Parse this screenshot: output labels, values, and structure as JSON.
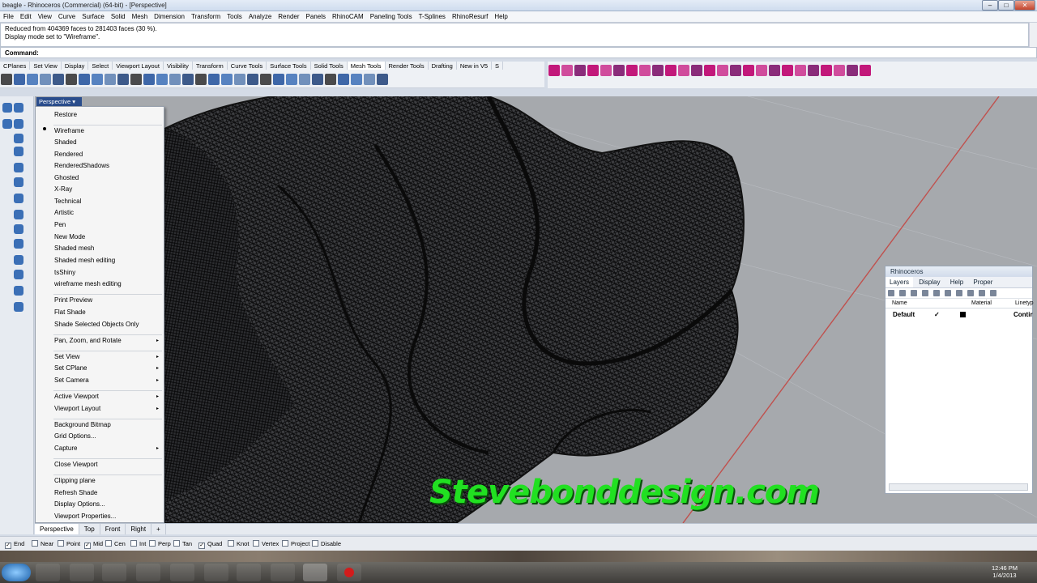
{
  "window": {
    "title": "beagle - Rhinoceros (Commercial) (64-bit) - [Perspective]"
  },
  "menu": [
    "File",
    "Edit",
    "View",
    "Curve",
    "Surface",
    "Solid",
    "Mesh",
    "Dimension",
    "Transform",
    "Tools",
    "Analyze",
    "Render",
    "Panels",
    "RhinoCAM",
    "Paneling Tools",
    "T-Splines",
    "RhinoResurf",
    "Help"
  ],
  "command_history": [
    "Reduced from 404369 faces to 281403 faces (30 %).",
    "Display mode set to \"Wireframe\"."
  ],
  "command": {
    "label": "Command:",
    "value": ""
  },
  "toolbar_tabs": [
    "CPlanes",
    "Set View",
    "Display",
    "Select",
    "Viewport Layout",
    "Visibility",
    "Transform",
    "Curve Tools",
    "Surface Tools",
    "Solid Tools",
    "Mesh Tools",
    "Render Tools",
    "Drafting",
    "New in V5",
    "S"
  ],
  "active_toolbar_tab": "Mesh Tools",
  "viewport": {
    "title": "Perspective"
  },
  "context_menu": {
    "items": [
      "Restore",
      "Wireframe",
      "Shaded",
      "Rendered",
      "RenderedShadows",
      "Ghosted",
      "X-Ray",
      "Technical",
      "Artistic",
      "Pen",
      "New Mode",
      "Shaded mesh",
      "Shaded mesh editing",
      "tsShiny",
      "wireframe mesh editing",
      "Print Preview",
      "Flat Shade",
      "Shade Selected Objects Only",
      "Pan, Zoom, and Rotate",
      "Set View",
      "Set CPlane",
      "Set Camera",
      "Active Viewport",
      "Viewport Layout",
      "Background Bitmap",
      "Grid Options...",
      "Capture",
      "Close Viewport",
      "Clipping plane",
      "Refresh Shade",
      "Display Options...",
      "Viewport Properties..."
    ],
    "checked": "Wireframe",
    "submenu_arrow": "▸"
  },
  "panel": {
    "title": "Rhinoceros",
    "tabs": [
      "Layers",
      "Display",
      "Help",
      "Proper"
    ],
    "columns": [
      "Name",
      "Material",
      "Linetyp"
    ],
    "rows": [
      {
        "name": "Default",
        "check": "✓",
        "linetype": "Contir"
      }
    ]
  },
  "viewport_tabs": [
    "Perspective",
    "Top",
    "Front",
    "Right",
    "+"
  ],
  "osnaps": [
    {
      "label": "End",
      "on": true
    },
    {
      "label": "Near",
      "on": false
    },
    {
      "label": "Point",
      "on": false
    },
    {
      "label": "Mid",
      "on": true
    },
    {
      "label": "Cen",
      "on": false
    },
    {
      "label": "Int",
      "on": false
    },
    {
      "label": "Perp",
      "on": false
    },
    {
      "label": "Tan",
      "on": false
    },
    {
      "label": "Quad",
      "on": true
    },
    {
      "label": "Knot",
      "on": false
    },
    {
      "label": "Vertex",
      "on": false
    },
    {
      "label": "Project",
      "on": false
    },
    {
      "label": "Disable",
      "on": false
    }
  ],
  "clock": {
    "time": "12:46 PM",
    "date": "1/4/2013"
  },
  "watermark": "Stevebonddesign.com",
  "colors": {
    "accent": "#2a4d8c",
    "watermark": "#21e021",
    "axis": "#c0504d"
  }
}
